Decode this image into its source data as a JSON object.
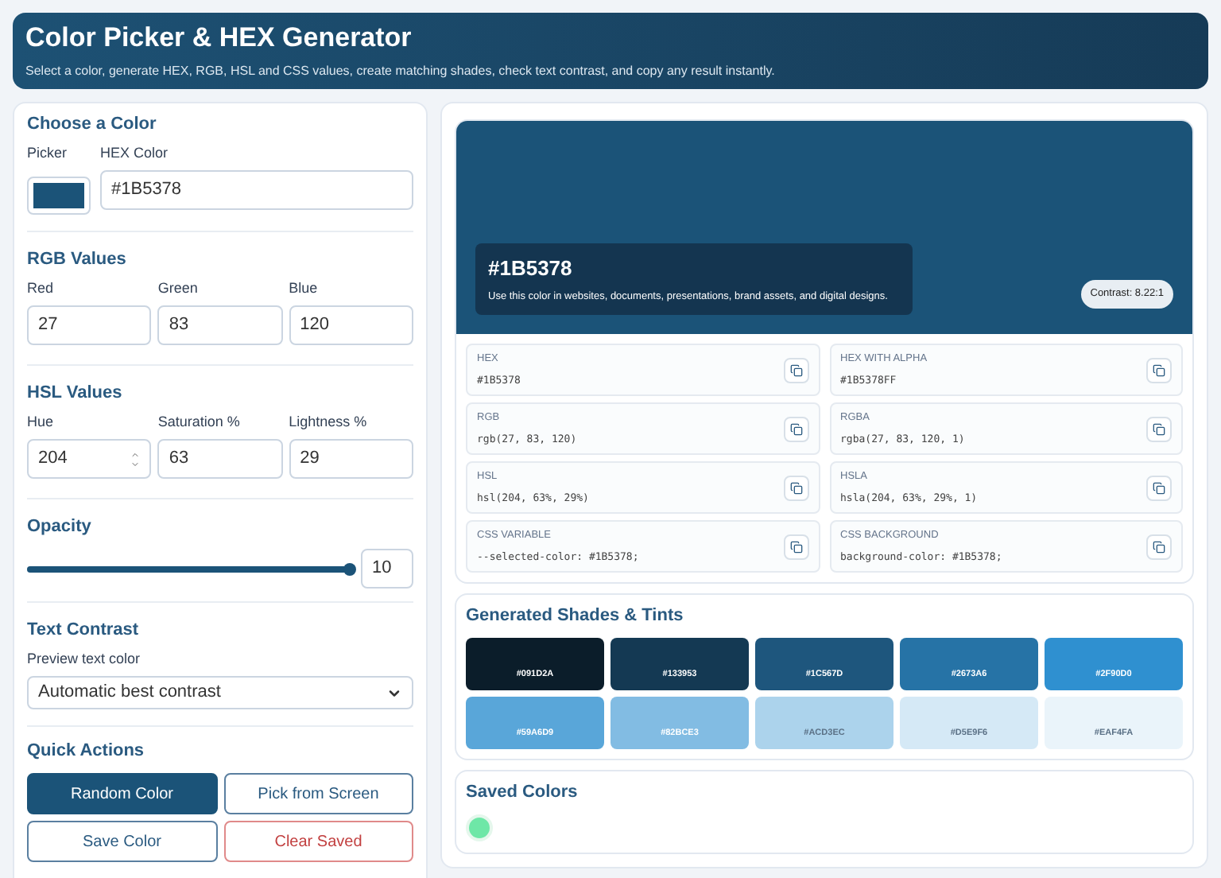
{
  "header": {
    "title": "Color Picker & HEX Generator",
    "subtitle": "Select a color, generate HEX, RGB, HSL and CSS values, create matching shades, check text contrast, and copy any result instantly."
  },
  "choose": {
    "title": "Choose a Color",
    "picker_label": "Picker",
    "hex_label": "HEX Color",
    "hex_value": "#1B5378"
  },
  "rgb": {
    "title": "RGB Values",
    "fields": [
      {
        "label": "Red",
        "value": "27"
      },
      {
        "label": "Green",
        "value": "83"
      },
      {
        "label": "Blue",
        "value": "120"
      }
    ]
  },
  "hsl": {
    "title": "HSL Values",
    "fields": [
      {
        "label": "Hue",
        "value": "204",
        "kind": "spinner"
      },
      {
        "label": "Saturation %",
        "value": "63",
        "kind": "plain"
      },
      {
        "label": "Lightness %",
        "value": "29",
        "kind": "plain"
      }
    ]
  },
  "opacity": {
    "title": "Opacity",
    "level": 1,
    "value": "10"
  },
  "contrast": {
    "title": "Text Contrast",
    "label": "Preview text color",
    "value": "Automatic best contrast"
  },
  "actions": {
    "title": "Quick Actions",
    "buttons": [
      {
        "label": "Random Color",
        "kind": "primary"
      },
      {
        "label": "Pick from Screen",
        "kind": "outline"
      },
      {
        "label": "Save Color",
        "kind": "outline"
      },
      {
        "label": "Clear Saved",
        "kind": "danger"
      }
    ]
  },
  "preview": {
    "color": "#1b5378",
    "hex": "#1B5378",
    "caption": "Use this color in websites, documents, presentations, brand assets, and digital designs.",
    "contrast": "Contrast: 8.22:1"
  },
  "formats": [
    {
      "label": "HEX",
      "value": "#1B5378"
    },
    {
      "label": "HEX WITH ALPHA",
      "value": "#1B5378FF"
    },
    {
      "label": "RGB",
      "value": "rgb(27, 83, 120)"
    },
    {
      "label": "RGBA",
      "value": "rgba(27, 83, 120, 1)"
    },
    {
      "label": "HSL",
      "value": "hsl(204, 63%, 29%)"
    },
    {
      "label": "HSLA",
      "value": "hsla(204, 63%, 29%, 1)"
    },
    {
      "label": "CSS VARIABLE",
      "value": "--selected-color: #1B5378;"
    },
    {
      "label": "CSS BACKGROUND",
      "value": "background-color: #1B5378;"
    }
  ],
  "shades": {
    "title": "Generated Shades & Tints",
    "items": [
      {
        "label": "#091D2A",
        "color": "#0b1d2a"
      },
      {
        "label": "#133953",
        "color": "#143953"
      },
      {
        "label": "#1C567D",
        "color": "#1e567d"
      },
      {
        "label": "#2673A6",
        "color": "#2673a6"
      },
      {
        "label": "#2F90D0",
        "color": "#2f90d0"
      },
      {
        "label": "#59A6D9",
        "color": "#59a6d9"
      },
      {
        "label": "#82BCE3",
        "color": "#82bce3"
      },
      {
        "label": "#ACD3EC",
        "color": "#acd3ec"
      },
      {
        "label": "#D5E9F6",
        "color": "#d5e9f6"
      },
      {
        "label": "#EAF4FA",
        "color": "#eaf4fa"
      }
    ]
  },
  "saved": {
    "title": "Saved Colors",
    "items": [
      {
        "color": "#6ee7a7"
      }
    ]
  }
}
